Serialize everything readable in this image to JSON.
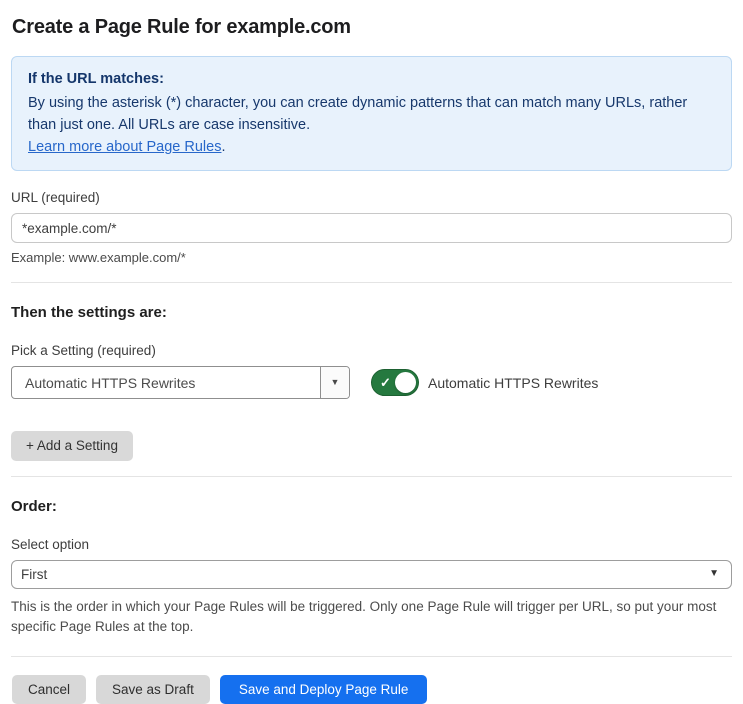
{
  "page": {
    "title": "Create a Page Rule for example.com"
  },
  "info_box": {
    "heading": "If the URL matches:",
    "body": "By using the asterisk (*) character, you can create dynamic patterns that can match many URLs, rather than just one. All URLs are case insensitive.",
    "link_text": "Learn more about Page Rules",
    "link_suffix": "."
  },
  "url_field": {
    "label": "URL (required)",
    "value": "*example.com/*",
    "helper": "Example: www.example.com/*"
  },
  "settings_section": {
    "heading": "Then the settings are:",
    "picker_label": "Pick a Setting (required)",
    "picker_value": "Automatic HTTPS Rewrites",
    "picker_caret": "▼",
    "toggle_state": "on",
    "toggle_check": "✓",
    "toggle_label": "Automatic HTTPS Rewrites",
    "add_button_label": "+ Add a Setting"
  },
  "order_section": {
    "heading": "Order:",
    "select_label": "Select option",
    "select_value": "First",
    "select_caret": "▼",
    "helper": "This is the order in which your Page Rules will be triggered. Only one Page Rule will trigger per URL, so put your most specific Page Rules at the top."
  },
  "footer": {
    "cancel_label": "Cancel",
    "save_draft_label": "Save as Draft",
    "save_deploy_label": "Save and Deploy Page Rule"
  },
  "colors": {
    "info_box_bg": "#e8f2fc",
    "info_box_border": "#bcd8f3",
    "info_text": "#17386c",
    "link_blue": "#2767ca",
    "toggle_green": "#25793f",
    "primary_button_blue": "#1570ef",
    "gray_button": "#d8d8d8"
  }
}
